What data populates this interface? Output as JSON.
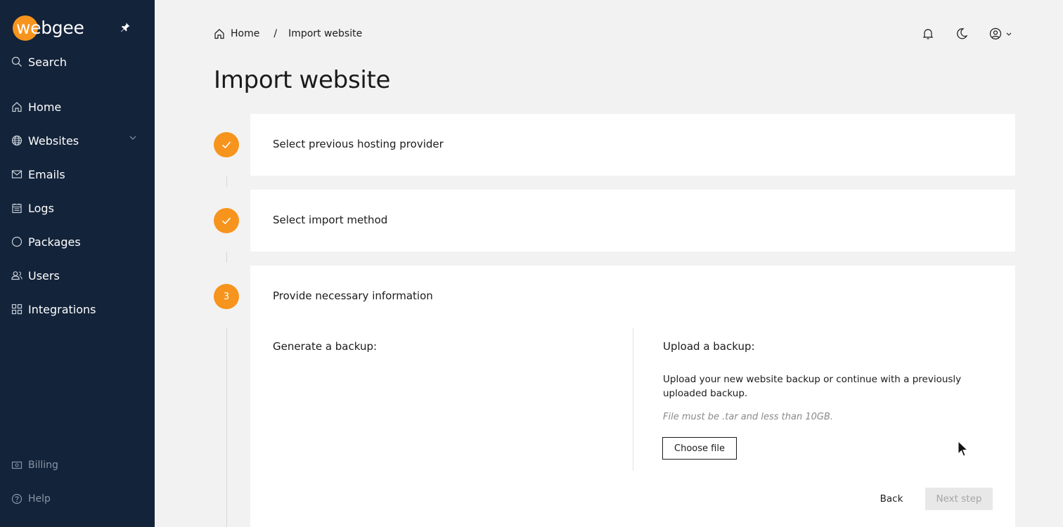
{
  "brand": {
    "logo_text": "webgee",
    "accent": "#f7941d",
    "sidebar_bg": "#13233a"
  },
  "sidebar": {
    "search_label": "Search",
    "items": [
      {
        "label": "Home",
        "icon": "home-icon"
      },
      {
        "label": "Websites",
        "icon": "globe-icon",
        "has_chevron": true
      },
      {
        "label": "Emails",
        "icon": "mail-icon"
      },
      {
        "label": "Logs",
        "icon": "calendar-icon"
      },
      {
        "label": "Packages",
        "icon": "circle-icon"
      },
      {
        "label": "Users",
        "icon": "users-icon"
      },
      {
        "label": "Integrations",
        "icon": "grid-icon"
      }
    ],
    "bottom_items": [
      {
        "label": "Billing",
        "icon": "billing-icon"
      },
      {
        "label": "Help",
        "icon": "help-icon"
      }
    ]
  },
  "header": {
    "breadcrumb": {
      "home": "Home",
      "separator": "/",
      "current": "Import website"
    },
    "icons": [
      "bell-icon",
      "moon-icon",
      "user-circle-icon"
    ]
  },
  "page": {
    "title": "Import website"
  },
  "steps": [
    {
      "marker": "✓",
      "title": "Select previous hosting provider",
      "status": "complete"
    },
    {
      "marker": "✓",
      "title": "Select import method",
      "status": "complete"
    },
    {
      "marker": "3",
      "title": "Provide necessary information",
      "status": "active"
    }
  ],
  "step3": {
    "generate_title": "Generate a backup:",
    "upload_title": "Upload a backup:",
    "upload_description": "Upload your new website backup or continue with a previously uploaded backup.",
    "file_hint": "File must be .tar and less than 10GB.",
    "choose_file_label": "Choose file",
    "back_label": "Back",
    "next_label": "Next step"
  }
}
